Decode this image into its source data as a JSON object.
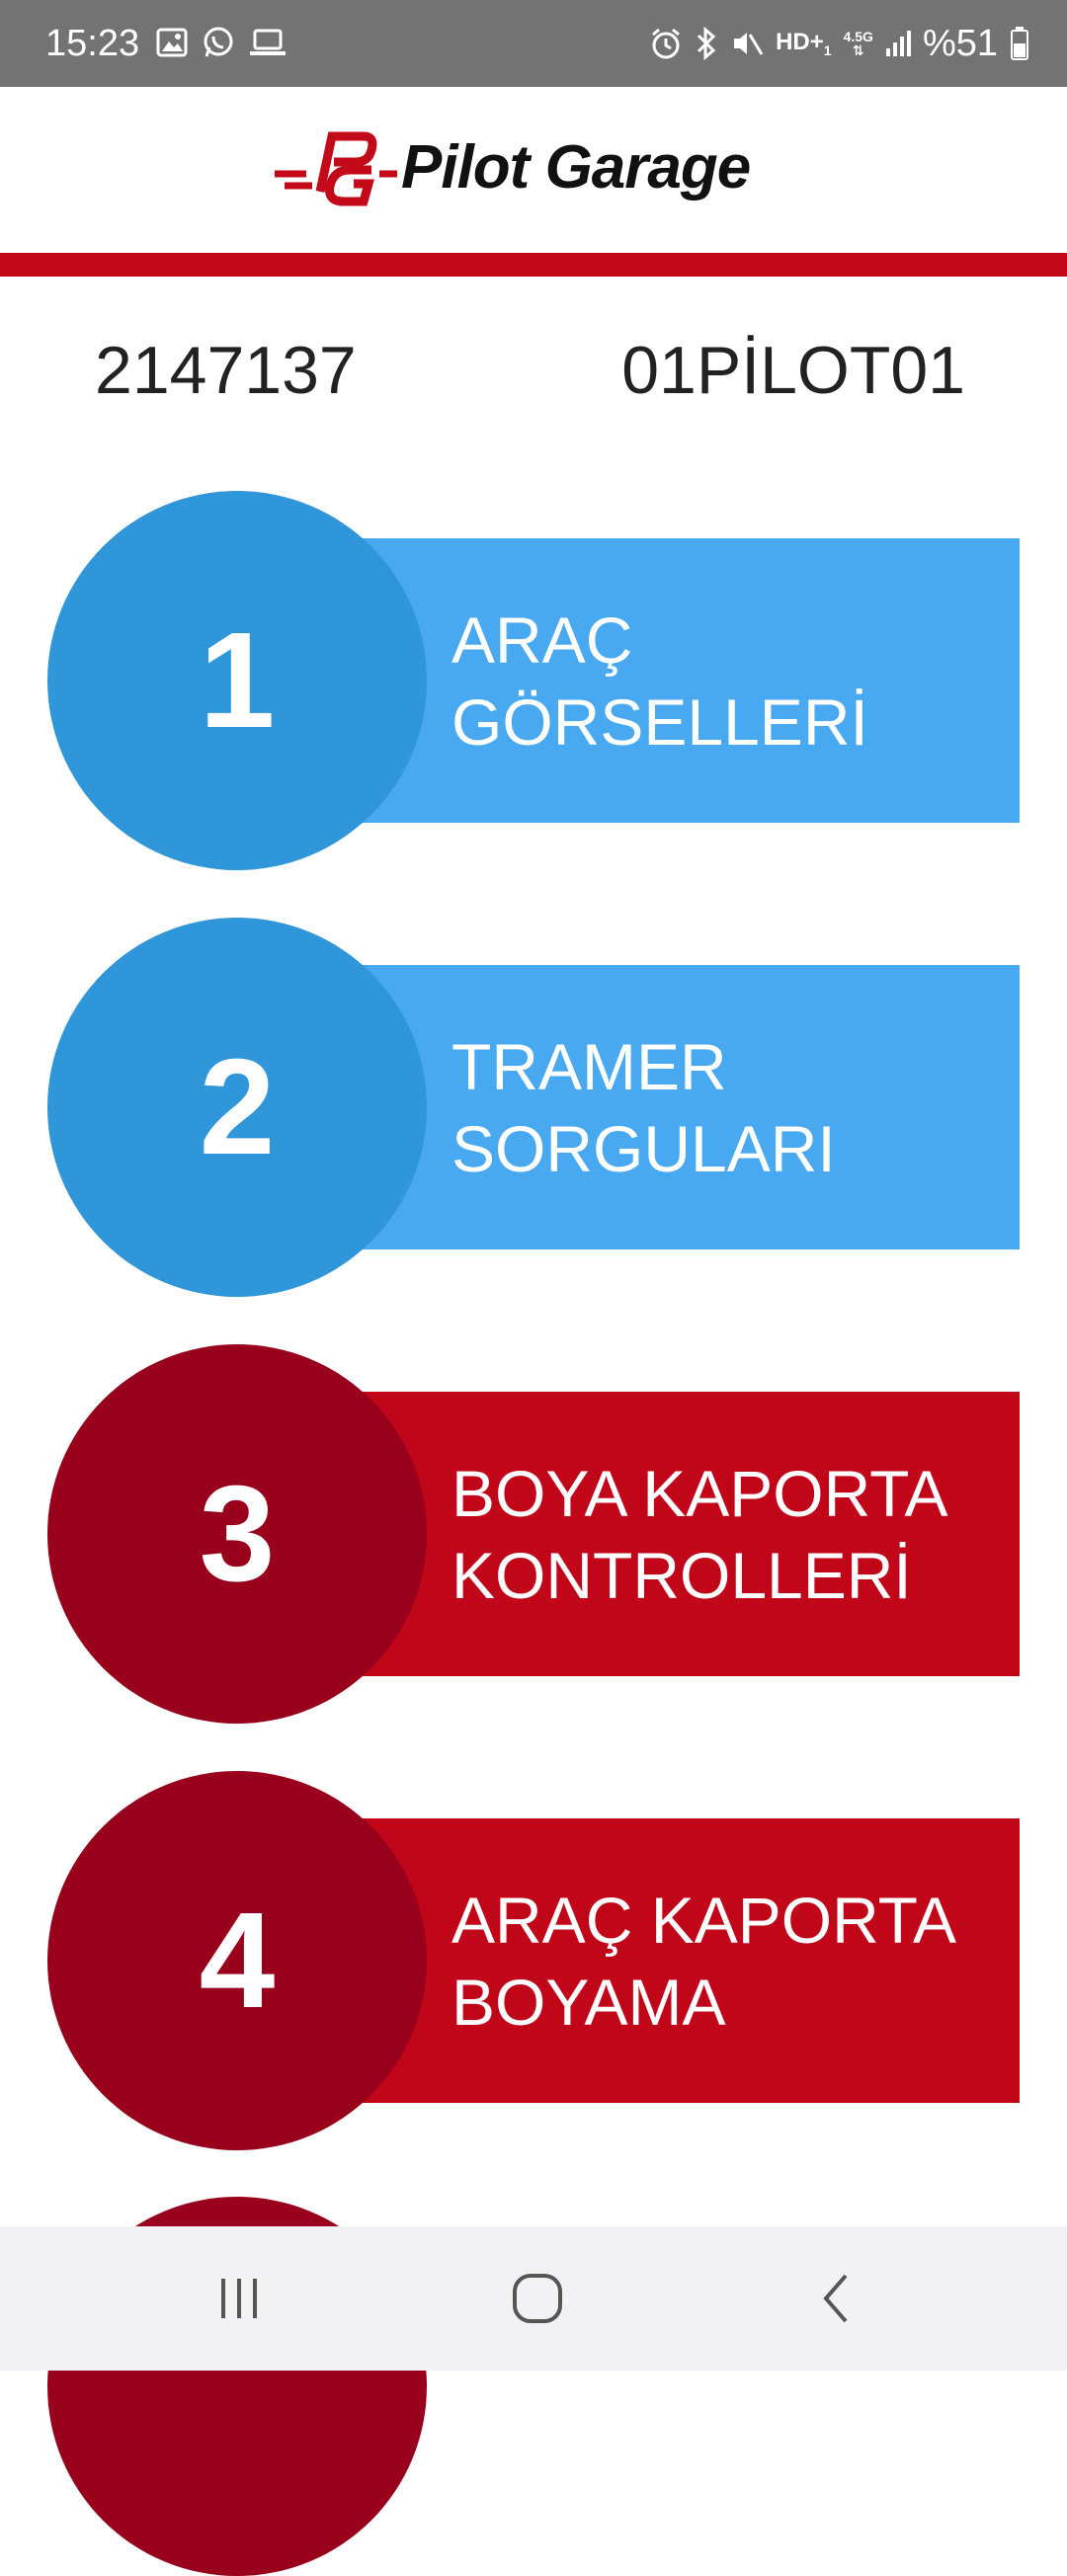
{
  "status_bar": {
    "time": "15:23",
    "hd_label": "HD+",
    "hd_sub": "1",
    "network_label": "4.5G",
    "battery_label": "%51",
    "left_icons": [
      "image-icon",
      "whatsapp-icon",
      "laptop-icon"
    ],
    "right_icons": [
      "alarm-icon",
      "bluetooth-icon",
      "mute-icon",
      "signal-icon",
      "battery-icon"
    ]
  },
  "header": {
    "logo_monogram": "PG",
    "brand_pilot": "Pilot",
    "brand_garage": "Garage",
    "accent_color": "#c20a1a"
  },
  "info": {
    "left_code": "2147137",
    "right_code": "01PİLOT01"
  },
  "menu": [
    {
      "number": "1",
      "label": "ARAÇ\nGÖRSELLERİ",
      "theme": "blue"
    },
    {
      "number": "2",
      "label": "TRAMER\nSORGULARI",
      "theme": "blue"
    },
    {
      "number": "3",
      "label": "BOYA KAPORTA\nKONTROLLERİ",
      "theme": "red"
    },
    {
      "number": "4",
      "label": "ARAÇ KAPORTA\nBOYAMA",
      "theme": "red"
    }
  ],
  "colors": {
    "blue_band": "#48a9f0",
    "blue_circle": "#2f96da",
    "red_band": "#c1061a",
    "red_circle": "#98001b"
  },
  "nav": {
    "buttons": [
      "recents-icon",
      "home-icon",
      "back-icon"
    ]
  }
}
